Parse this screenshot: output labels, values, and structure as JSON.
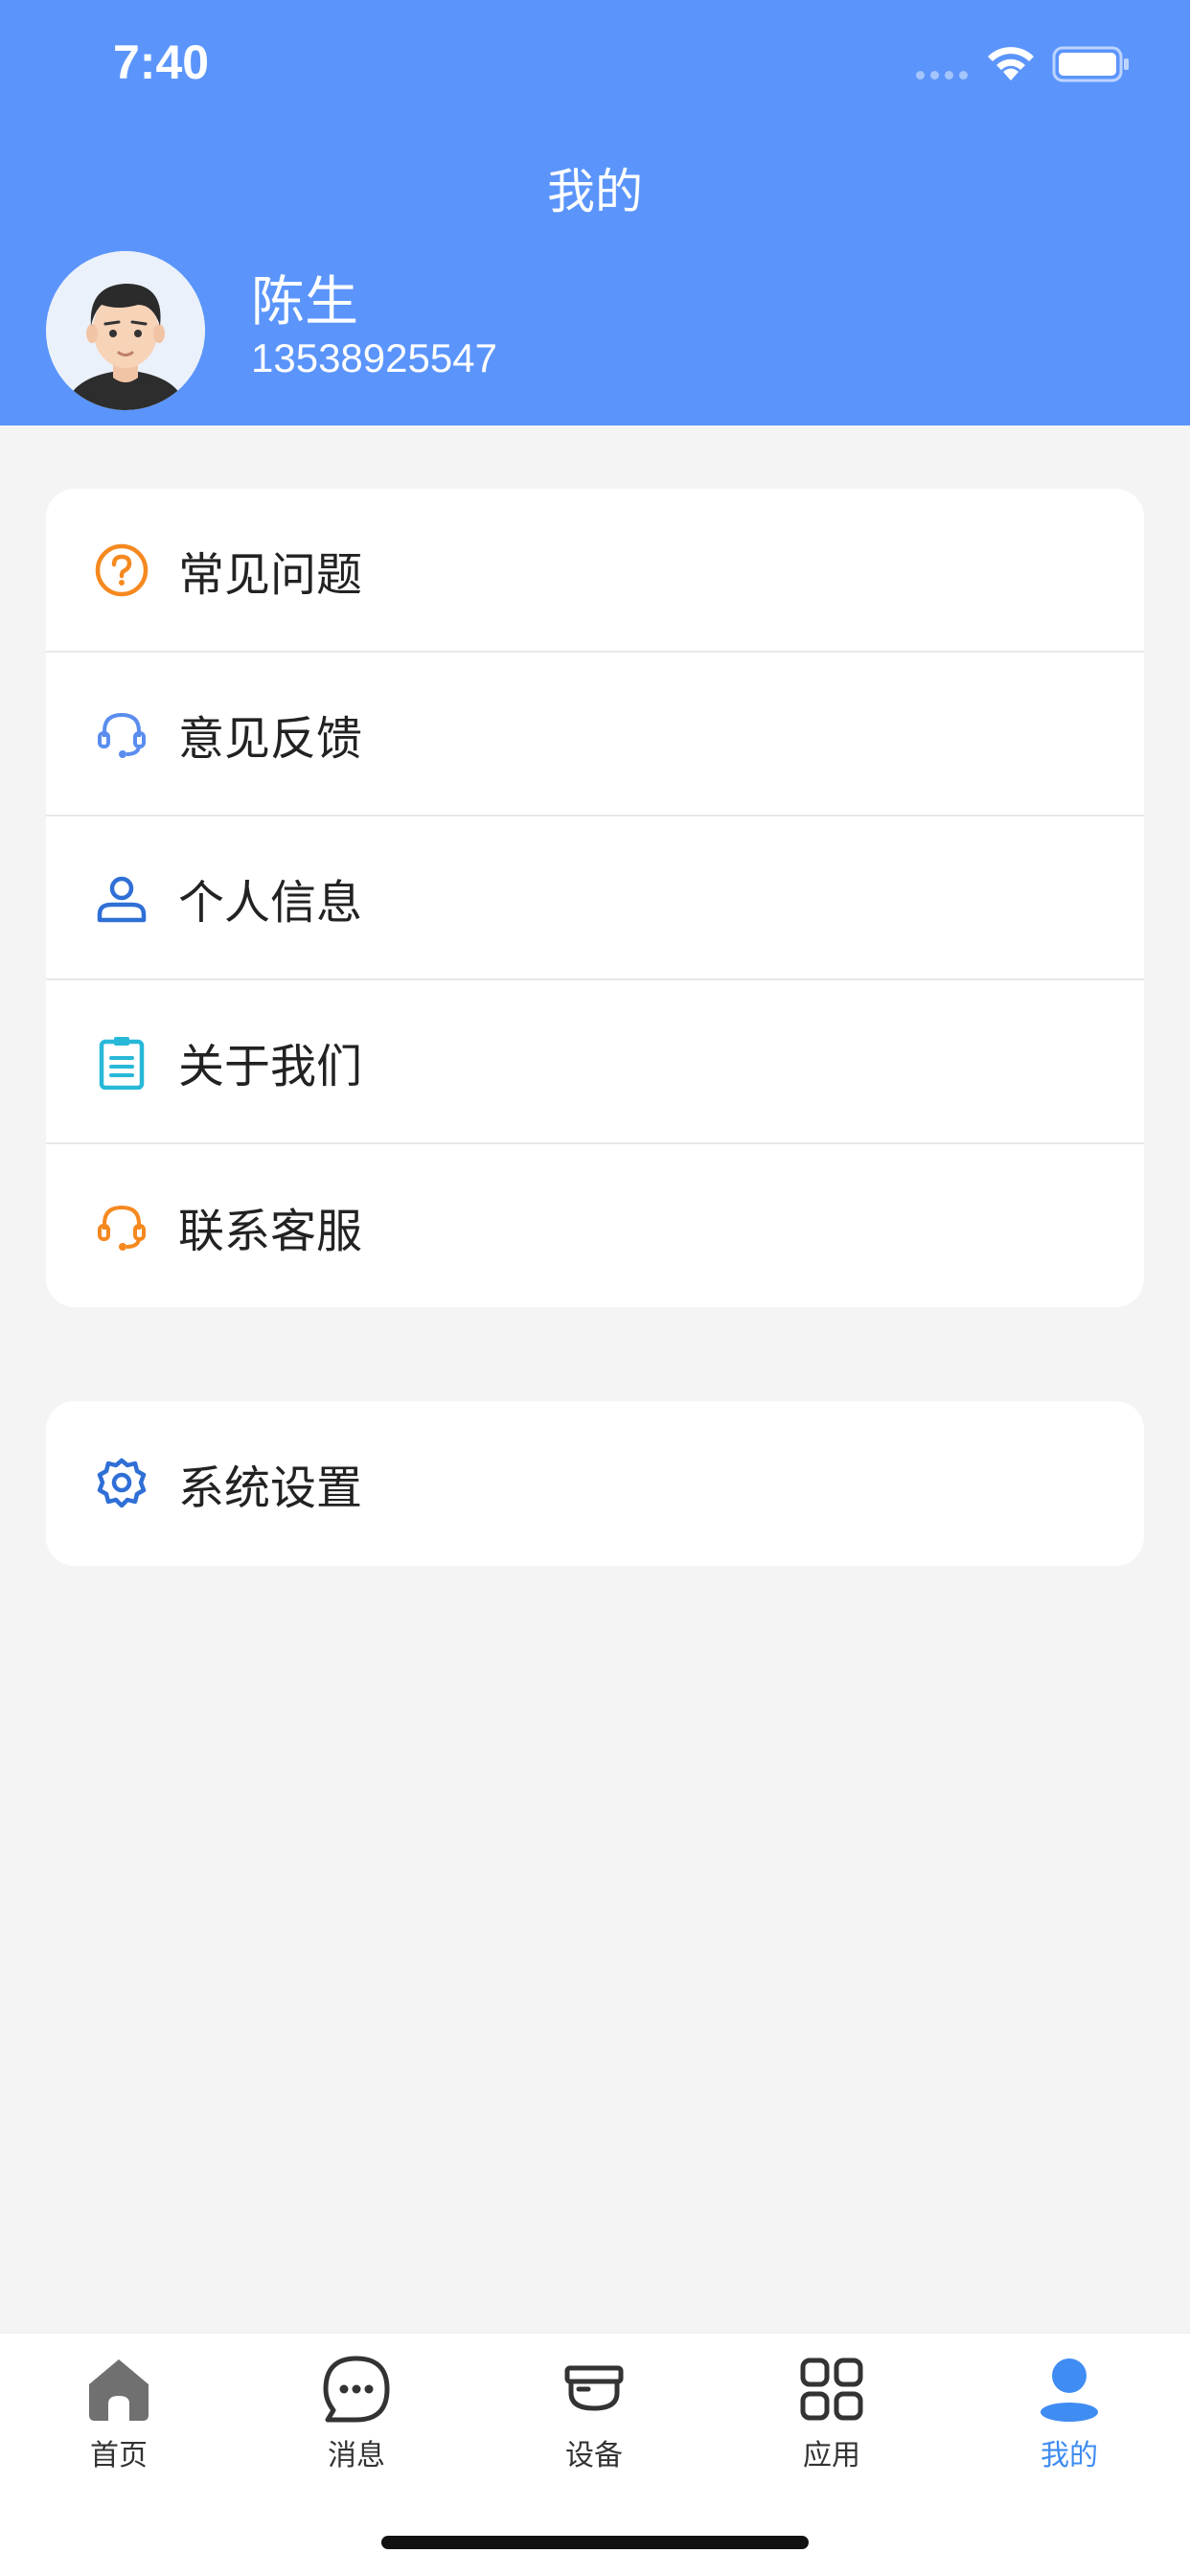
{
  "status_bar": {
    "time": "7:40"
  },
  "header": {
    "title": "我的",
    "user_name": "陈生",
    "phone": "13538925547"
  },
  "menu": {
    "items": [
      {
        "label": "常见问题",
        "icon": "question-circle-icon",
        "color": "#f5891f"
      },
      {
        "label": "意见反馈",
        "icon": "headset-icon",
        "color": "#5b8def"
      },
      {
        "label": "个人信息",
        "icon": "person-icon",
        "color": "#2f6fd6"
      },
      {
        "label": "关于我们",
        "icon": "clipboard-icon",
        "color": "#28b8d8"
      },
      {
        "label": "联系客服",
        "icon": "headset-icon",
        "color": "#f5891f"
      }
    ]
  },
  "settings": {
    "label": "系统设置",
    "icon": "gear-icon",
    "color": "#2f6fd6"
  },
  "tabbar": {
    "tabs": [
      {
        "label": "首页",
        "icon": "home-icon"
      },
      {
        "label": "消息",
        "icon": "chat-bubble-icon"
      },
      {
        "label": "设备",
        "icon": "camera-device-icon"
      },
      {
        "label": "应用",
        "icon": "apps-grid-icon"
      },
      {
        "label": "我的",
        "icon": "user-icon",
        "active": true
      }
    ],
    "active_color": "#3f8cf2"
  },
  "colors": {
    "header_bg": "#5b95fb",
    "page_bg": "#f4f4f4"
  }
}
